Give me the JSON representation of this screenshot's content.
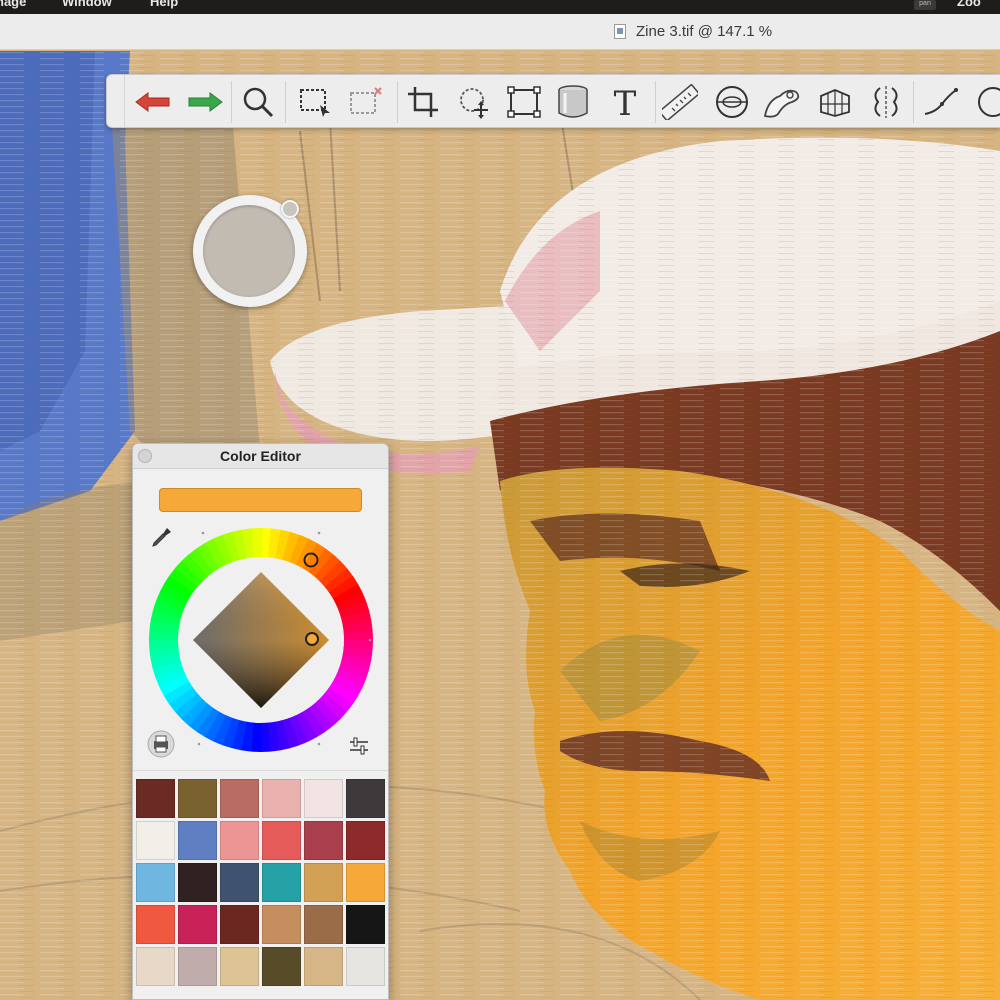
{
  "menubar": {
    "items": [
      "nage",
      "Window",
      "Help"
    ],
    "right_badge": "pan",
    "right_text": "Zoo"
  },
  "window": {
    "title": "Zine 3.tif @ 147.1 %"
  },
  "toolbar": {
    "tools": [
      {
        "name": "undo-icon",
        "color": "#d6453a"
      },
      {
        "name": "redo-icon",
        "color": "#3aa84a"
      },
      {
        "name": "zoom-icon"
      },
      {
        "name": "rect-select-icon"
      },
      {
        "name": "clear-selection-icon"
      },
      {
        "name": "crop-icon"
      },
      {
        "name": "lasso-transform-icon"
      },
      {
        "name": "transform-icon"
      },
      {
        "name": "fill-bucket-icon"
      },
      {
        "name": "text-tool-icon",
        "label": "T"
      },
      {
        "name": "ruler-icon"
      },
      {
        "name": "ellipse-guide-icon"
      },
      {
        "name": "french-curve-icon"
      },
      {
        "name": "perspective-guide-icon"
      },
      {
        "name": "symmetry-icon"
      },
      {
        "name": "stroke-icon"
      },
      {
        "name": "shape-icon"
      }
    ]
  },
  "puck": {
    "color": "#c2bbb2"
  },
  "color_editor": {
    "title": "Color Editor",
    "current_color": "#f6a838",
    "swatches": [
      "#6b2b24",
      "#7a6130",
      "#b86c62",
      "#e8b2ae",
      "#f3e4e4",
      "#3e3a3c",
      "#f1efe8",
      "#5f7fc2",
      "#ec9594",
      "#e45b5a",
      "#a93f4d",
      "#8c2a2c",
      "#6fb6e0",
      "#2f2220",
      "#3f526e",
      "#25a2a6",
      "#d2a155",
      "#f6a838",
      "#f0583f",
      "#c92258",
      "#6b2820",
      "#c48e5e",
      "#9a6c48",
      "#161616",
      "#e8d8c8",
      "#c0acaa",
      "#dcc494",
      "#584b28",
      "#d6b686",
      "#e7e5e2"
    ]
  }
}
